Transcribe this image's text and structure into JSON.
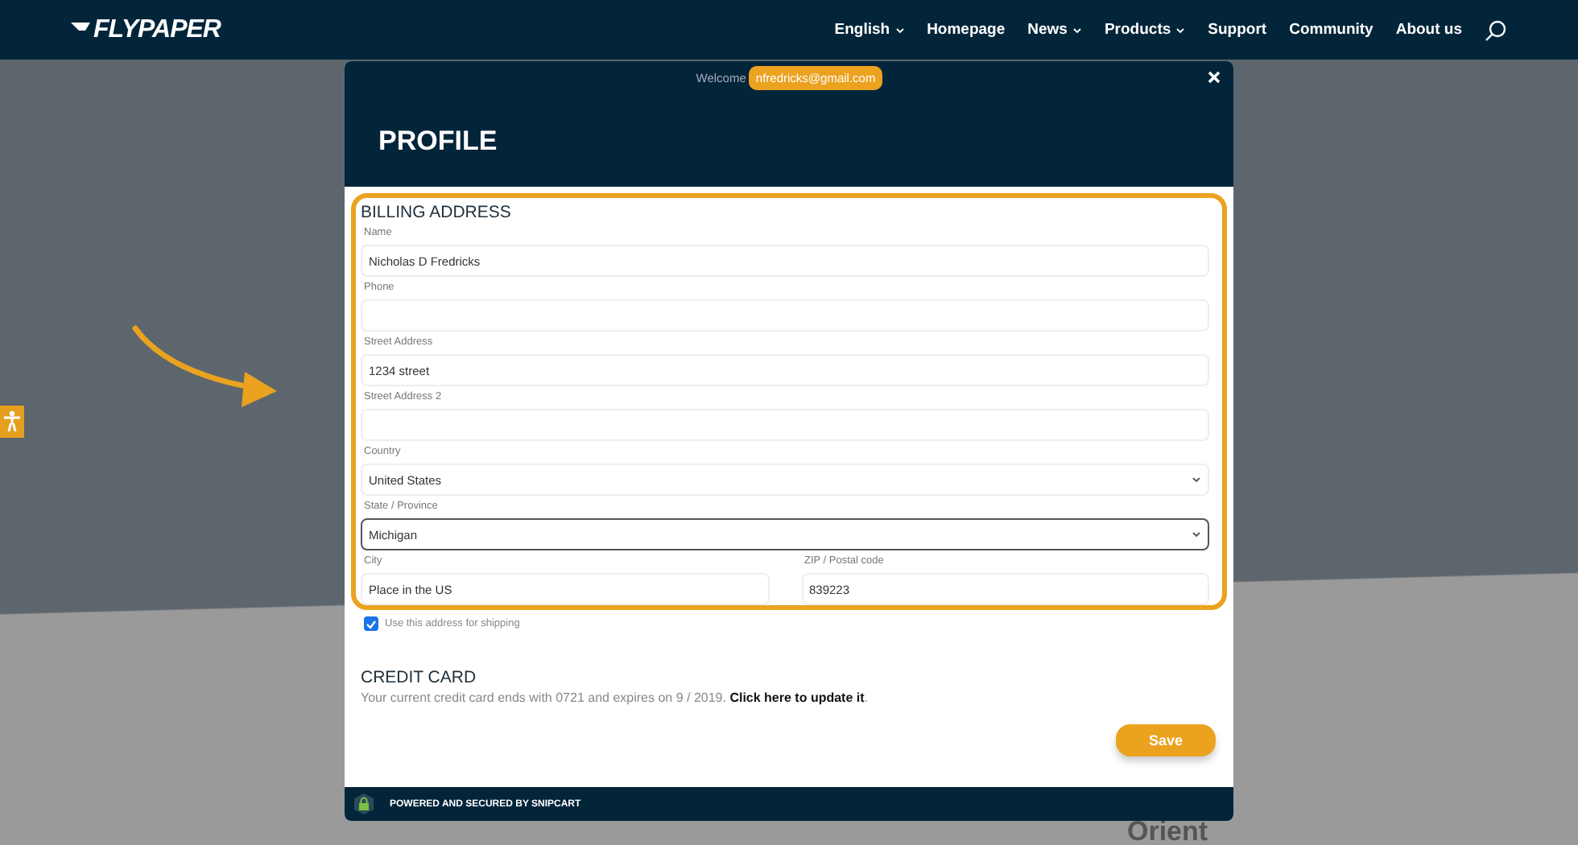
{
  "nav": {
    "logo": "FLYPAPER",
    "items": [
      {
        "label": "English",
        "has_dropdown": true
      },
      {
        "label": "Homepage",
        "has_dropdown": false
      },
      {
        "label": "News",
        "has_dropdown": true
      },
      {
        "label": "Products",
        "has_dropdown": true
      },
      {
        "label": "Support",
        "has_dropdown": false
      },
      {
        "label": "Community",
        "has_dropdown": false
      },
      {
        "label": "About us",
        "has_dropdown": false
      }
    ]
  },
  "background": {
    "heading": "Orient"
  },
  "modal": {
    "welcome": "Welcome",
    "email": "nfredricks@gmail.com",
    "title": "PROFILE",
    "billing": {
      "title": "BILLING ADDRESS",
      "highlighted": true,
      "rows": [
        {
          "fields": [
            {
              "kind": "input",
              "label": "Name",
              "value": "Nicholas D Fredricks",
              "focused": false
            }
          ]
        },
        {
          "fields": [
            {
              "kind": "input",
              "label": "Phone",
              "focused": false
            }
          ]
        },
        {
          "fields": [
            {
              "kind": "input",
              "label": "Street Address",
              "value": "1234 street",
              "focused": false
            }
          ]
        },
        {
          "fields": [
            {
              "kind": "input",
              "label": "Street Address 2",
              "focused": false
            }
          ]
        },
        {
          "fields": [
            {
              "kind": "select",
              "label": "Country",
              "value": "United States",
              "focused": false
            }
          ]
        },
        {
          "fields": [
            {
              "kind": "select",
              "label": "State / Province",
              "value": "Michigan",
              "focused": true
            }
          ]
        },
        {
          "fields": [
            {
              "kind": "input",
              "label": "City",
              "value": "Place in the US",
              "focused": false
            },
            {
              "kind": "input",
              "label": "ZIP / Postal code",
              "value": "839223",
              "focused": false
            }
          ]
        }
      ]
    },
    "shipping": {
      "label": "Use this address for shipping",
      "checked": true
    },
    "credit_card": {
      "title": "CREDIT CARD",
      "text": "Your current credit card ends with 0721 and expires on 9 / 2019.",
      "link": "Click here to update it",
      "end": "."
    },
    "save": "Save",
    "footer": "POWERED AND SECURED BY SNIPCART"
  }
}
